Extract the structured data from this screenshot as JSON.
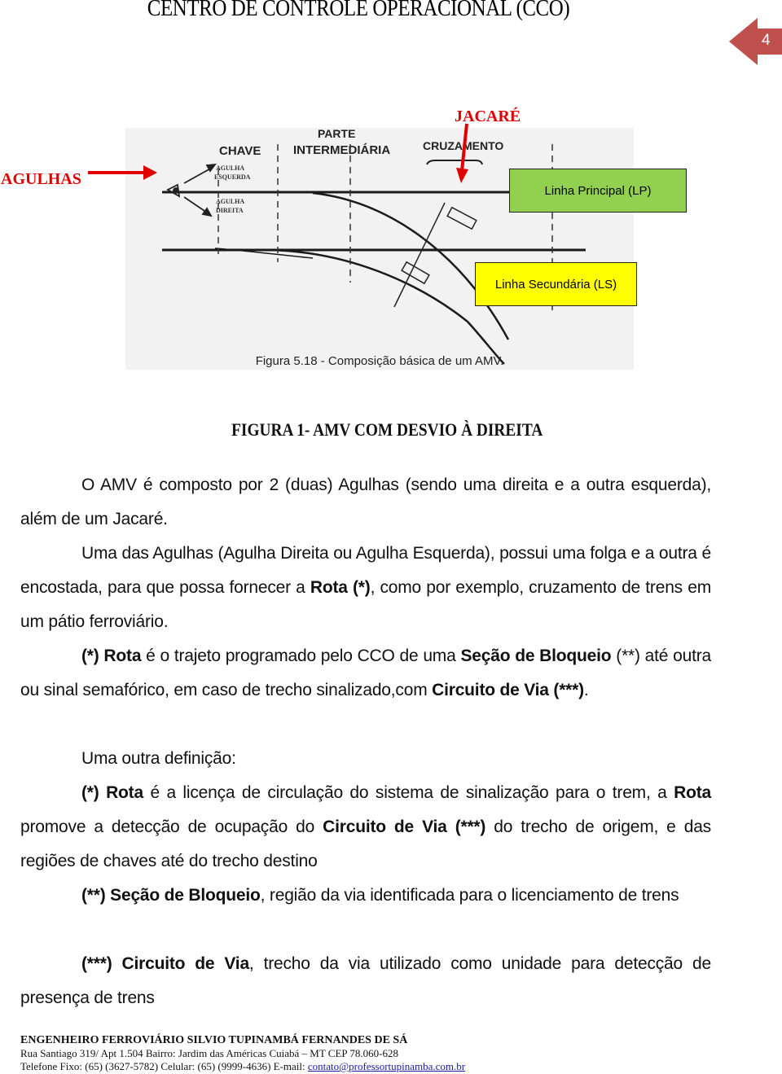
{
  "header": {
    "title": "CENTRO DE CONTROLE OPERACIONAL (CCO)",
    "page_number": "4",
    "badge_color": "#c0504d"
  },
  "figure": {
    "callouts": {
      "agulhas": "AGULHAS",
      "jacare": "JACARÉ"
    },
    "diagram_labels": {
      "chave": "CHAVE",
      "parte": "PARTE",
      "intermediaria": "INTERMEDIÁRIA",
      "cruzamento": "CRUZAMENTO",
      "agulha_esquerda_1": "AGULHA",
      "agulha_esquerda_2": "ESQUERDA",
      "agulha_direita_1": "AGULHA",
      "agulha_direita_2": "DIREITA",
      "inner_caption": "Figura 5.18 - Composição básica de um AMV."
    },
    "boxes": {
      "linha_principal": "Linha Principal (LP)",
      "linha_secundaria": "Linha Secundária (LS)"
    },
    "colors": {
      "callout": "#e00000",
      "lp_box": "#92d050",
      "ls_box": "#ffff00"
    },
    "caption": "FIGURA 1- AMV COM DESVIO À DIREITA"
  },
  "body": {
    "p1": "O AMV é composto por 2 (duas) Agulhas (sendo uma direita e a outra esquerda), além de um Jacaré.",
    "p2": {
      "t1": "Uma das Agulhas (Agulha Direita ou Agulha Esquerda), possui uma folga e a outra é encostada, para que possa fornecer a ",
      "b1": "Rota (*)",
      "t2": ", como por exemplo, cruzamento de trens em um pátio ferroviário."
    },
    "p3": {
      "b1": "(*) Rota",
      "t1": " é o trajeto programado pelo CCO de uma ",
      "b2": "Seção de Bloqueio",
      "t2": " (**) até outra ou sinal semafórico, em caso de trecho sinalizado,com ",
      "b3": "Circuito de Via (***)",
      "t3": "."
    },
    "p4": "Uma outra definição:",
    "p5": {
      "b1": "(*) Rota",
      "t1": " é a licença de circulação do sistema de sinalização para o trem, a ",
      "b2": "Rota",
      "t2": " promove a detecção de ocupação do ",
      "b3": "Circuito de Via (***)",
      "t3": " do trecho de origem, e das regiões de chaves até do trecho destino"
    },
    "p6": {
      "t0": "(**) ",
      "b1": "Seção de Bloqueio",
      "t1": ", região da via identificada para o licenciamento de trens"
    },
    "p7": {
      "t0": "(***) ",
      "b1": "Circuito de Via",
      "t1": ", trecho da via utilizado como unidade para detecção de presença de trens"
    }
  },
  "footer": {
    "name": "ENGENHEIRO FERROVIÁRIO SILVIO TUPINAMBÁ FERNANDES DE SÁ",
    "address": "Rua Santiago 319/ Apt 1.504   Bairro: Jardim das Américas  Cuiabá – MT  CEP 78.060-628",
    "phones": "Telefone Fixo: (65) (3627-5782)  Celular: (65) (9999-4636)  E-mail: ",
    "email": "contato@professortupinamba.com.br"
  }
}
